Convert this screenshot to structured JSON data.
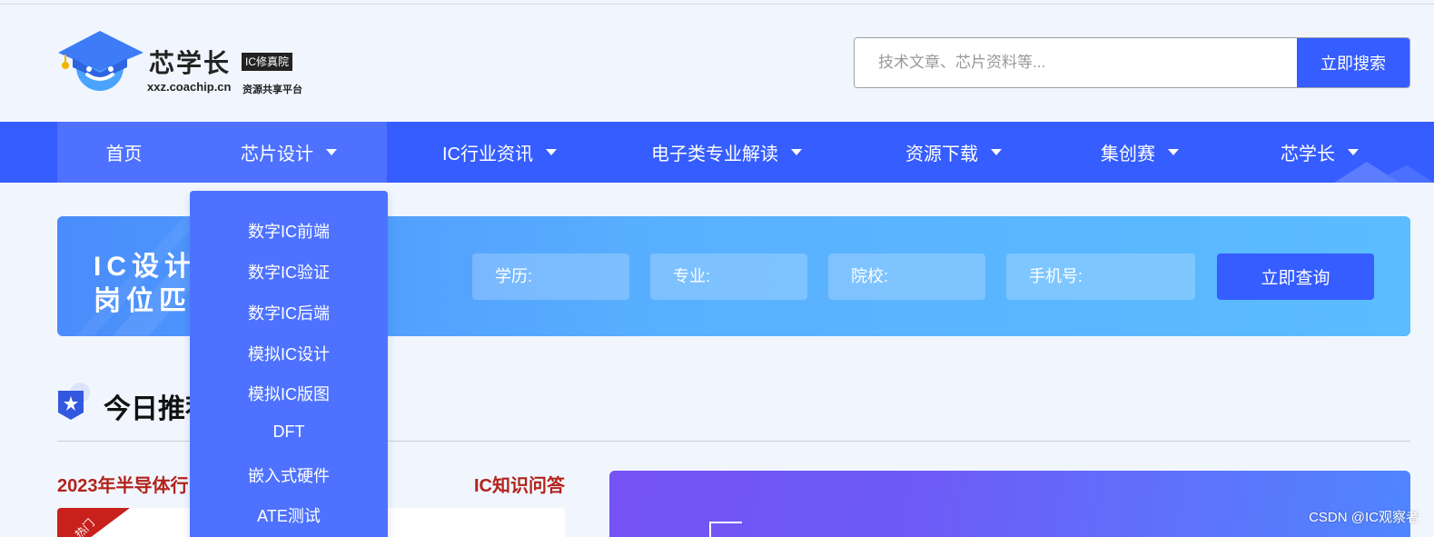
{
  "header": {
    "logo": {
      "title": "芯学长",
      "badge": "IC修真院",
      "domain": "xxz.coachip.cn",
      "tagline": "资源共享平台"
    },
    "search": {
      "placeholder": "技术文章、芯片资料等...",
      "value": "",
      "button_label": "立即搜索"
    }
  },
  "nav": {
    "items": [
      {
        "label": "首页",
        "has_caret": false
      },
      {
        "label": "芯片设计",
        "has_caret": true,
        "active": true
      },
      {
        "label": "IC行业资讯",
        "has_caret": true
      },
      {
        "label": "电子类专业解读",
        "has_caret": true
      },
      {
        "label": "资源下载",
        "has_caret": true
      },
      {
        "label": "集创赛",
        "has_caret": true
      },
      {
        "label": "芯学长",
        "has_caret": true
      }
    ]
  },
  "dropdown": {
    "items": [
      "数字IC前端",
      "数字IC验证",
      "数字IC后端",
      "模拟IC设计",
      "模拟IC版图",
      "DFT",
      "嵌入式硬件",
      "ATE测试"
    ]
  },
  "banner": {
    "title_line1": "IC设计",
    "title_line2": "岗位匹配",
    "fields": [
      {
        "placeholder": "学历:"
      },
      {
        "placeholder": "专业:"
      },
      {
        "placeholder": "院校:"
      },
      {
        "placeholder": "手机号:"
      }
    ],
    "query_button": "立即查询"
  },
  "section": {
    "title": "今日推荐",
    "left_heading": "2023年半导体行",
    "right_heading": "IC知识问答",
    "hot_badge": "热门"
  },
  "watermark": "CSDN @IC观察者",
  "colors": {
    "primary": "#355dff",
    "nav_active": "#4e72ff",
    "background": "#f1f6fe",
    "accent_red": "#b2231b"
  }
}
